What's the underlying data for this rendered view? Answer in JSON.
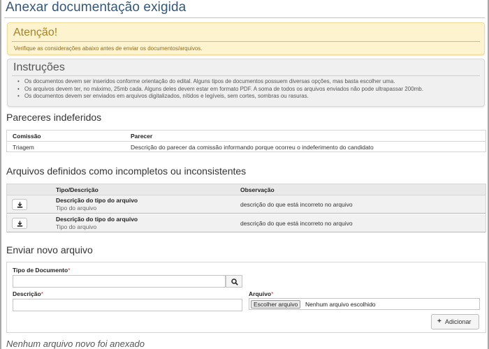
{
  "page": {
    "title": "Anexar documentação exigida"
  },
  "alert": {
    "title": "Atenção!",
    "text": "Verifique as considerações abaixo antes de enviar os documentos/arquivos."
  },
  "instructions": {
    "title": "Instruções",
    "items": [
      "Os documentos devem ser inseridos conforme orientação do edital. Alguns tipos de documentos possuem diversas opções, mas basta escolher uma.",
      "Os arquivos devem ter, no máximo, 25mb cada. Alguns deles devem estar em formato PDF. A soma de todos os arquivos enviados não pode ultrapassar 200mb.",
      "Os documentos devem ser enviados em arquivos digitalizados, nítidos e legíveis, sem cortes, sombras ou rasuras."
    ]
  },
  "rejected": {
    "title": "Pareceres indeferidos",
    "columns": [
      "Comissão",
      "Parecer"
    ],
    "rows": [
      {
        "commission": "Triagem",
        "opinion": "Descrição do parecer da comissão informando porque ocorreu o indeferimento do candidato"
      }
    ]
  },
  "incomplete": {
    "title": "Arquivos definidos como incompletos ou inconsistentes",
    "columns": [
      "Tipo/Descrição",
      "Observação"
    ],
    "rows": [
      {
        "type": "Descrição do tipo do arquivo",
        "subtype": "Tipo do arquivo",
        "observation": "descrição do que está incorreto no arquivo",
        "action_icon": "download-icon"
      },
      {
        "type": "Descrição do tipo do arquivo",
        "subtype": "Tipo do arquivo",
        "observation": "descrição do que está incorreto no arquivo",
        "action_icon": "download-icon"
      }
    ]
  },
  "upload": {
    "title": "Enviar novo arquivo",
    "doc_type_label": "Tipo de Documento",
    "doc_type_value": "",
    "description_label": "Descrição",
    "description_value": "",
    "file_label": "Arquivo",
    "file_button": "Escolher arquivo",
    "file_status": "Nenhum arquivo escolhido",
    "required_mark": "*",
    "add_button": "Adicionar",
    "add_icon": "+",
    "search_icon": "search-icon"
  },
  "empty_state": "Nenhum arquivo novo foi anexado",
  "colors": {
    "title": "#34577a",
    "alert_bg": "#fdf3cf",
    "alert_text": "#8d6d1e",
    "required": "#d13b3b"
  }
}
